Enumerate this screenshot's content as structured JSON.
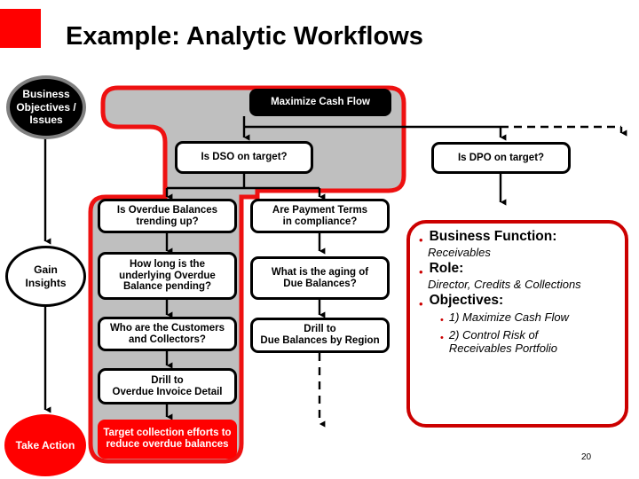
{
  "slide": {
    "title": "Example:  Analytic Workflows",
    "page_number": "20",
    "accent_red": "#ff0000",
    "panel_red": "#cc0000",
    "band_gray": "#bfbfbf"
  },
  "stages": [
    {
      "id": "objectives",
      "label": "Business\nObjectives /\nIssues",
      "style": "black-ellipse"
    },
    {
      "id": "insights",
      "label": "Gain\nInsights",
      "style": "white-ellipse"
    },
    {
      "id": "action",
      "label": "Take Action",
      "style": "red-ellipse"
    }
  ],
  "nodes": {
    "objective": "Maximize Cash Flow",
    "dso": "Is DSO on target?",
    "dpo": "Is DPO on target?",
    "overdue_trend": "Is Overdue Balances\ntrending up?",
    "payment_terms": "Are Payment Terms\nin compliance?",
    "overdue_pending": "How long is the\nunderlying Overdue\nBalance pending?",
    "aging_due": "What is the aging of\nDue Balances?",
    "customers_collectors": "Who are the Customers\nand Collectors?",
    "drill_region": "Drill to\nDue Balances by Region",
    "drill_invoice": "Drill to\nOverdue Invoice Detail",
    "action_box": "Target collection efforts to\nreduce overdue balances"
  },
  "info_panel": {
    "business_function_label": "Business Function:",
    "business_function_value": "Receivables",
    "role_label": "Role:",
    "role_value": "Director, Credits & Collections",
    "objectives_label": "Objectives:",
    "objectives": [
      "1) Maximize Cash Flow",
      "2) Control Risk of\nReceivables Portfolio"
    ]
  }
}
